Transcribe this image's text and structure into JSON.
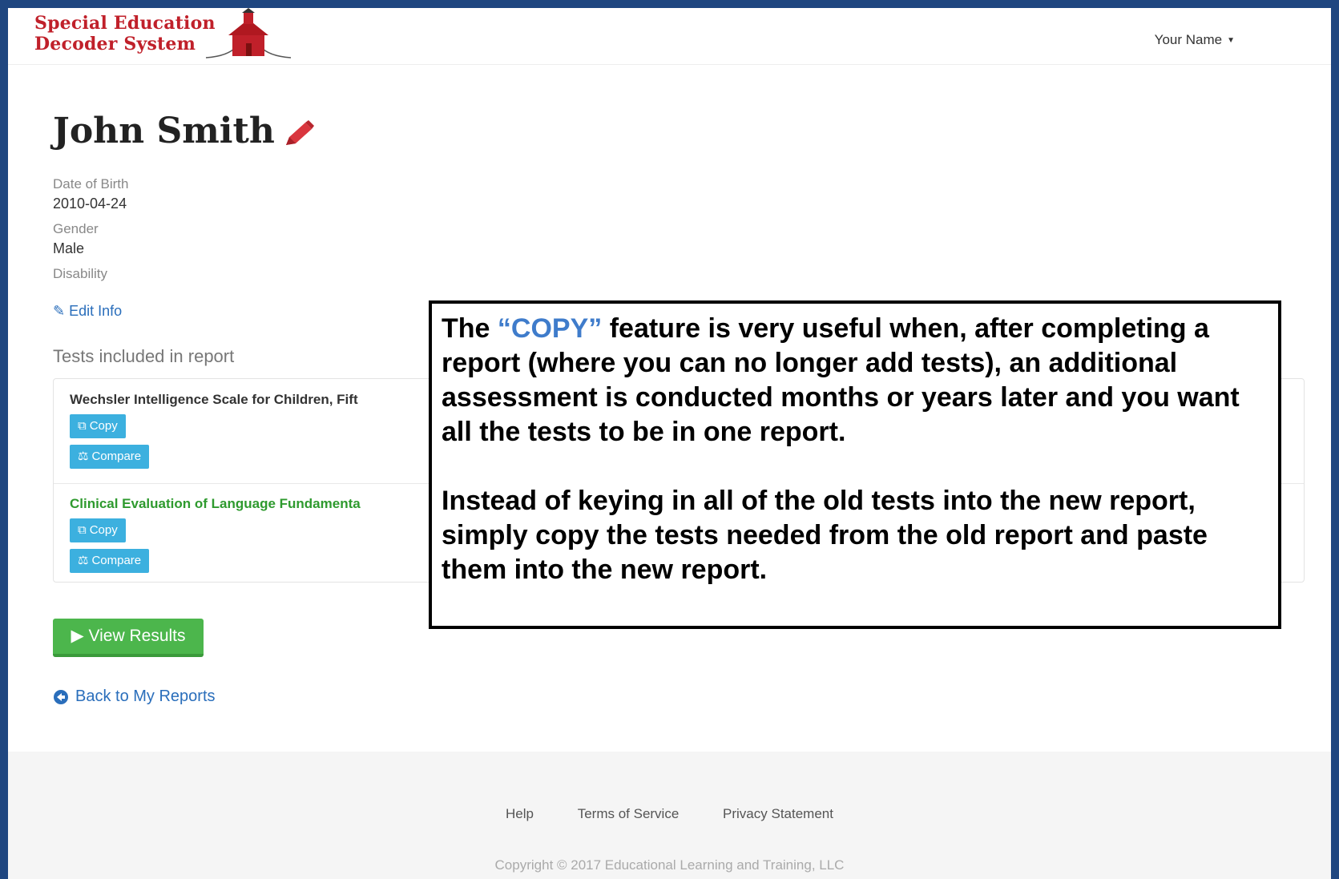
{
  "header": {
    "logo_line1": "Special Education",
    "logo_line2": "Decoder System",
    "user_menu": "Your Name"
  },
  "student": {
    "name": "John Smith",
    "dob_label": "Date of Birth",
    "dob_value": "2010-04-24",
    "gender_label": "Gender",
    "gender_value": "Male",
    "disability_label": "Disability",
    "edit_info": "Edit Info"
  },
  "tests": {
    "heading": "Tests included in report",
    "items": [
      {
        "title": "Wechsler Intelligence Scale for Children, Fift",
        "copy": "Copy",
        "compare": "Compare"
      },
      {
        "title": "Clinical Evaluation of Language Fundamenta",
        "copy": "Copy",
        "compare": "Compare"
      }
    ]
  },
  "actions": {
    "view_results": "View Results",
    "back": "Back to My Reports"
  },
  "callout": {
    "p1_prefix": "The ",
    "p1_highlight": "“COPY”",
    "p1_rest": " feature is very useful when, after completing a report (where you can no longer add tests), an additional assessment is conducted months or years later and you want all the tests to be in one report.",
    "p2": "Instead of keying in all of the old tests into the new report, simply copy the tests needed from the old report and paste them into the new report."
  },
  "footer": {
    "help": "Help",
    "terms": "Terms of Service",
    "privacy": "Privacy Statement",
    "copyright": "Copyright © 2017 Educational Learning and Training, LLC"
  },
  "colors": {
    "brand_red": "#c0202a",
    "link_blue": "#2a6ebb",
    "button_cyan": "#3cb0df",
    "button_green": "#4cb64c",
    "highlight_blue": "#3f7ccb",
    "frame_navy": "#1f4680"
  },
  "icons": [
    "schoolhouse-logo-icon",
    "pencil-icon",
    "copy-icon",
    "scale-icon",
    "play-icon",
    "back-arrow-icon",
    "caret-down-icon"
  ]
}
